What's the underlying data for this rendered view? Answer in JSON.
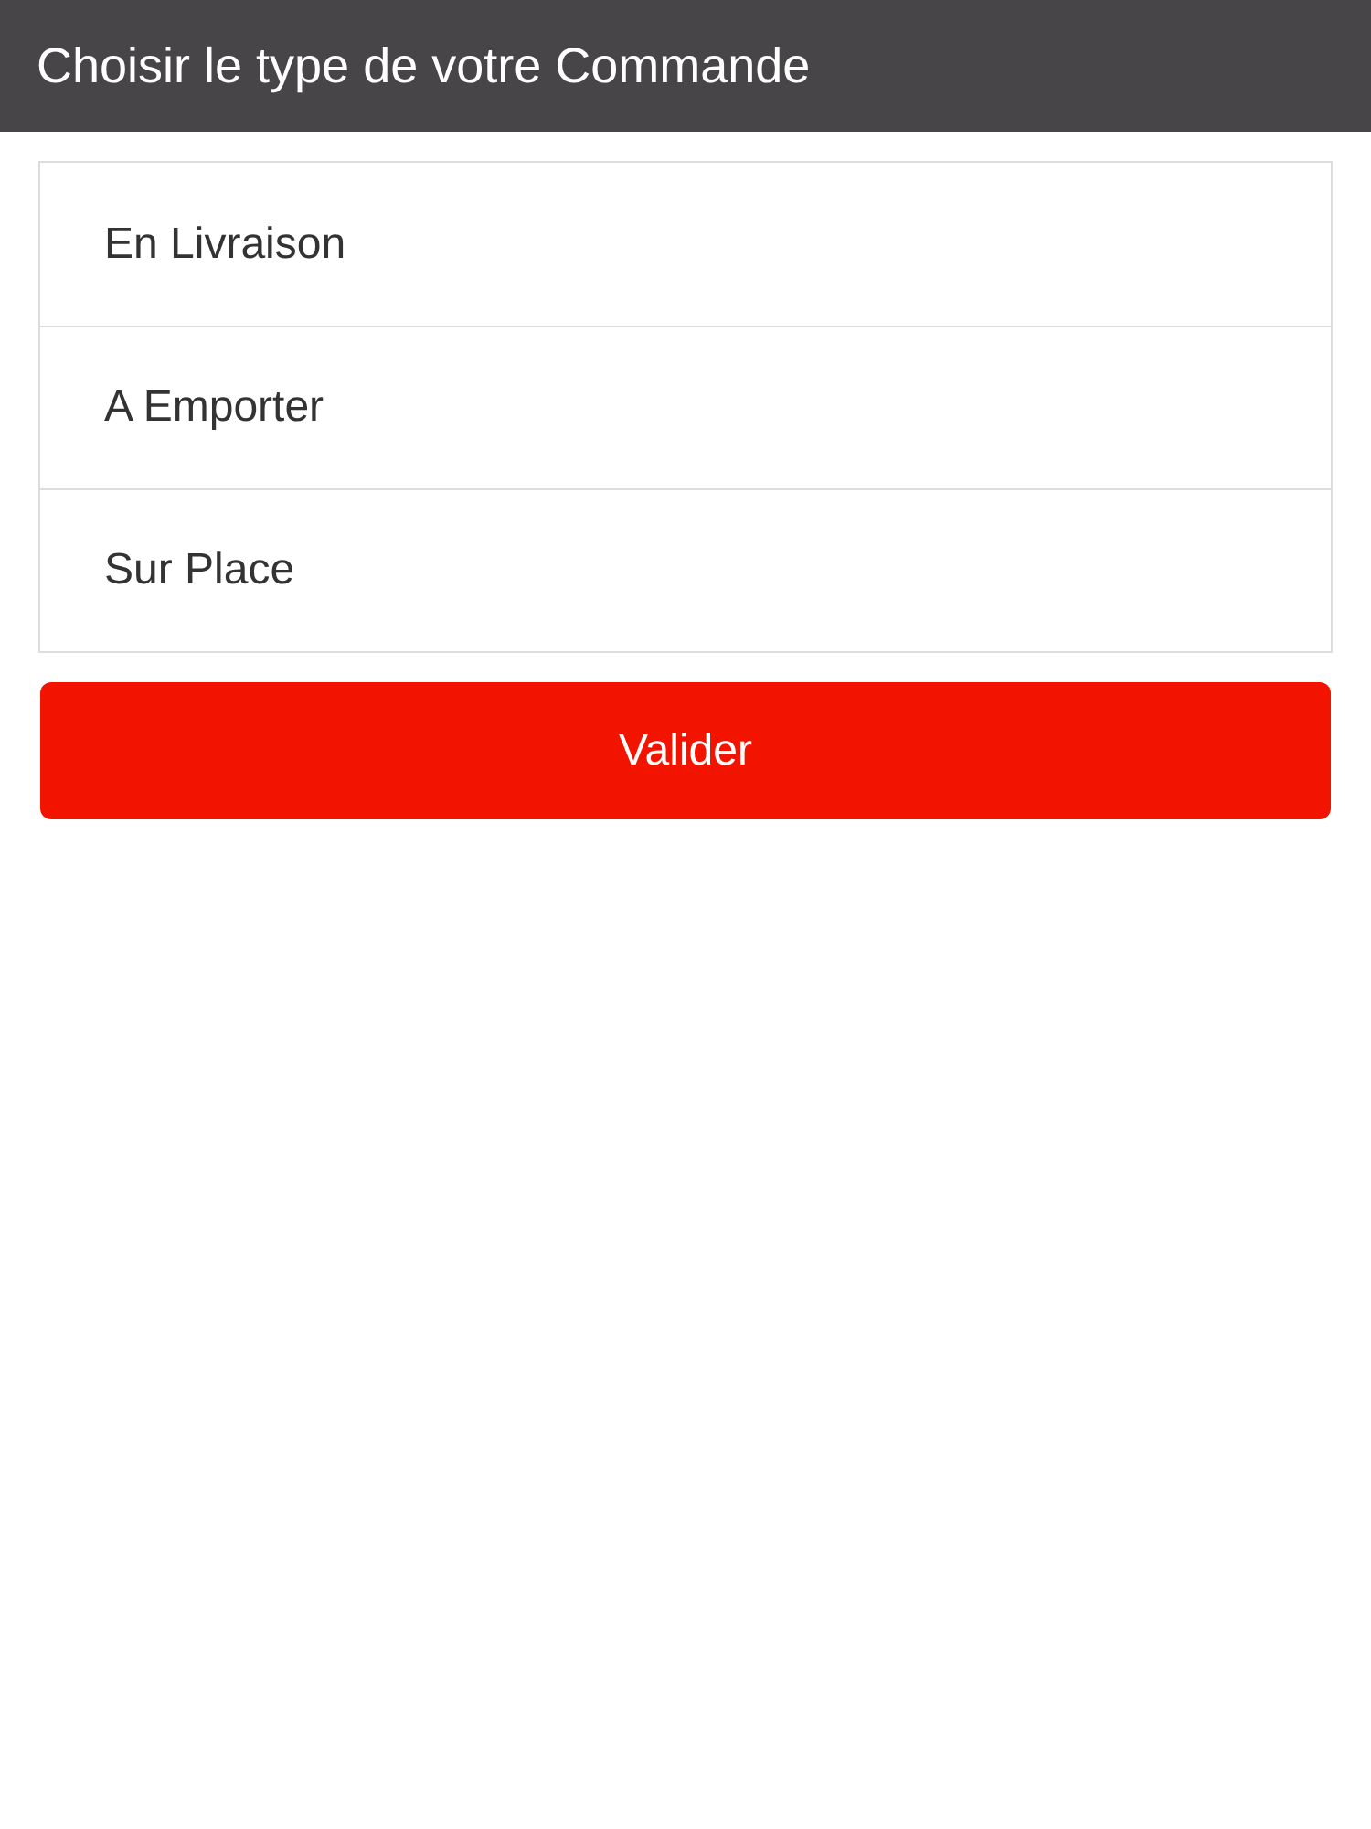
{
  "header": {
    "title": "Choisir le type de votre Commande"
  },
  "options": [
    {
      "label": "En Livraison"
    },
    {
      "label": "A Emporter"
    },
    {
      "label": "Sur Place"
    }
  ],
  "submit_button": {
    "label": "Valider"
  }
}
